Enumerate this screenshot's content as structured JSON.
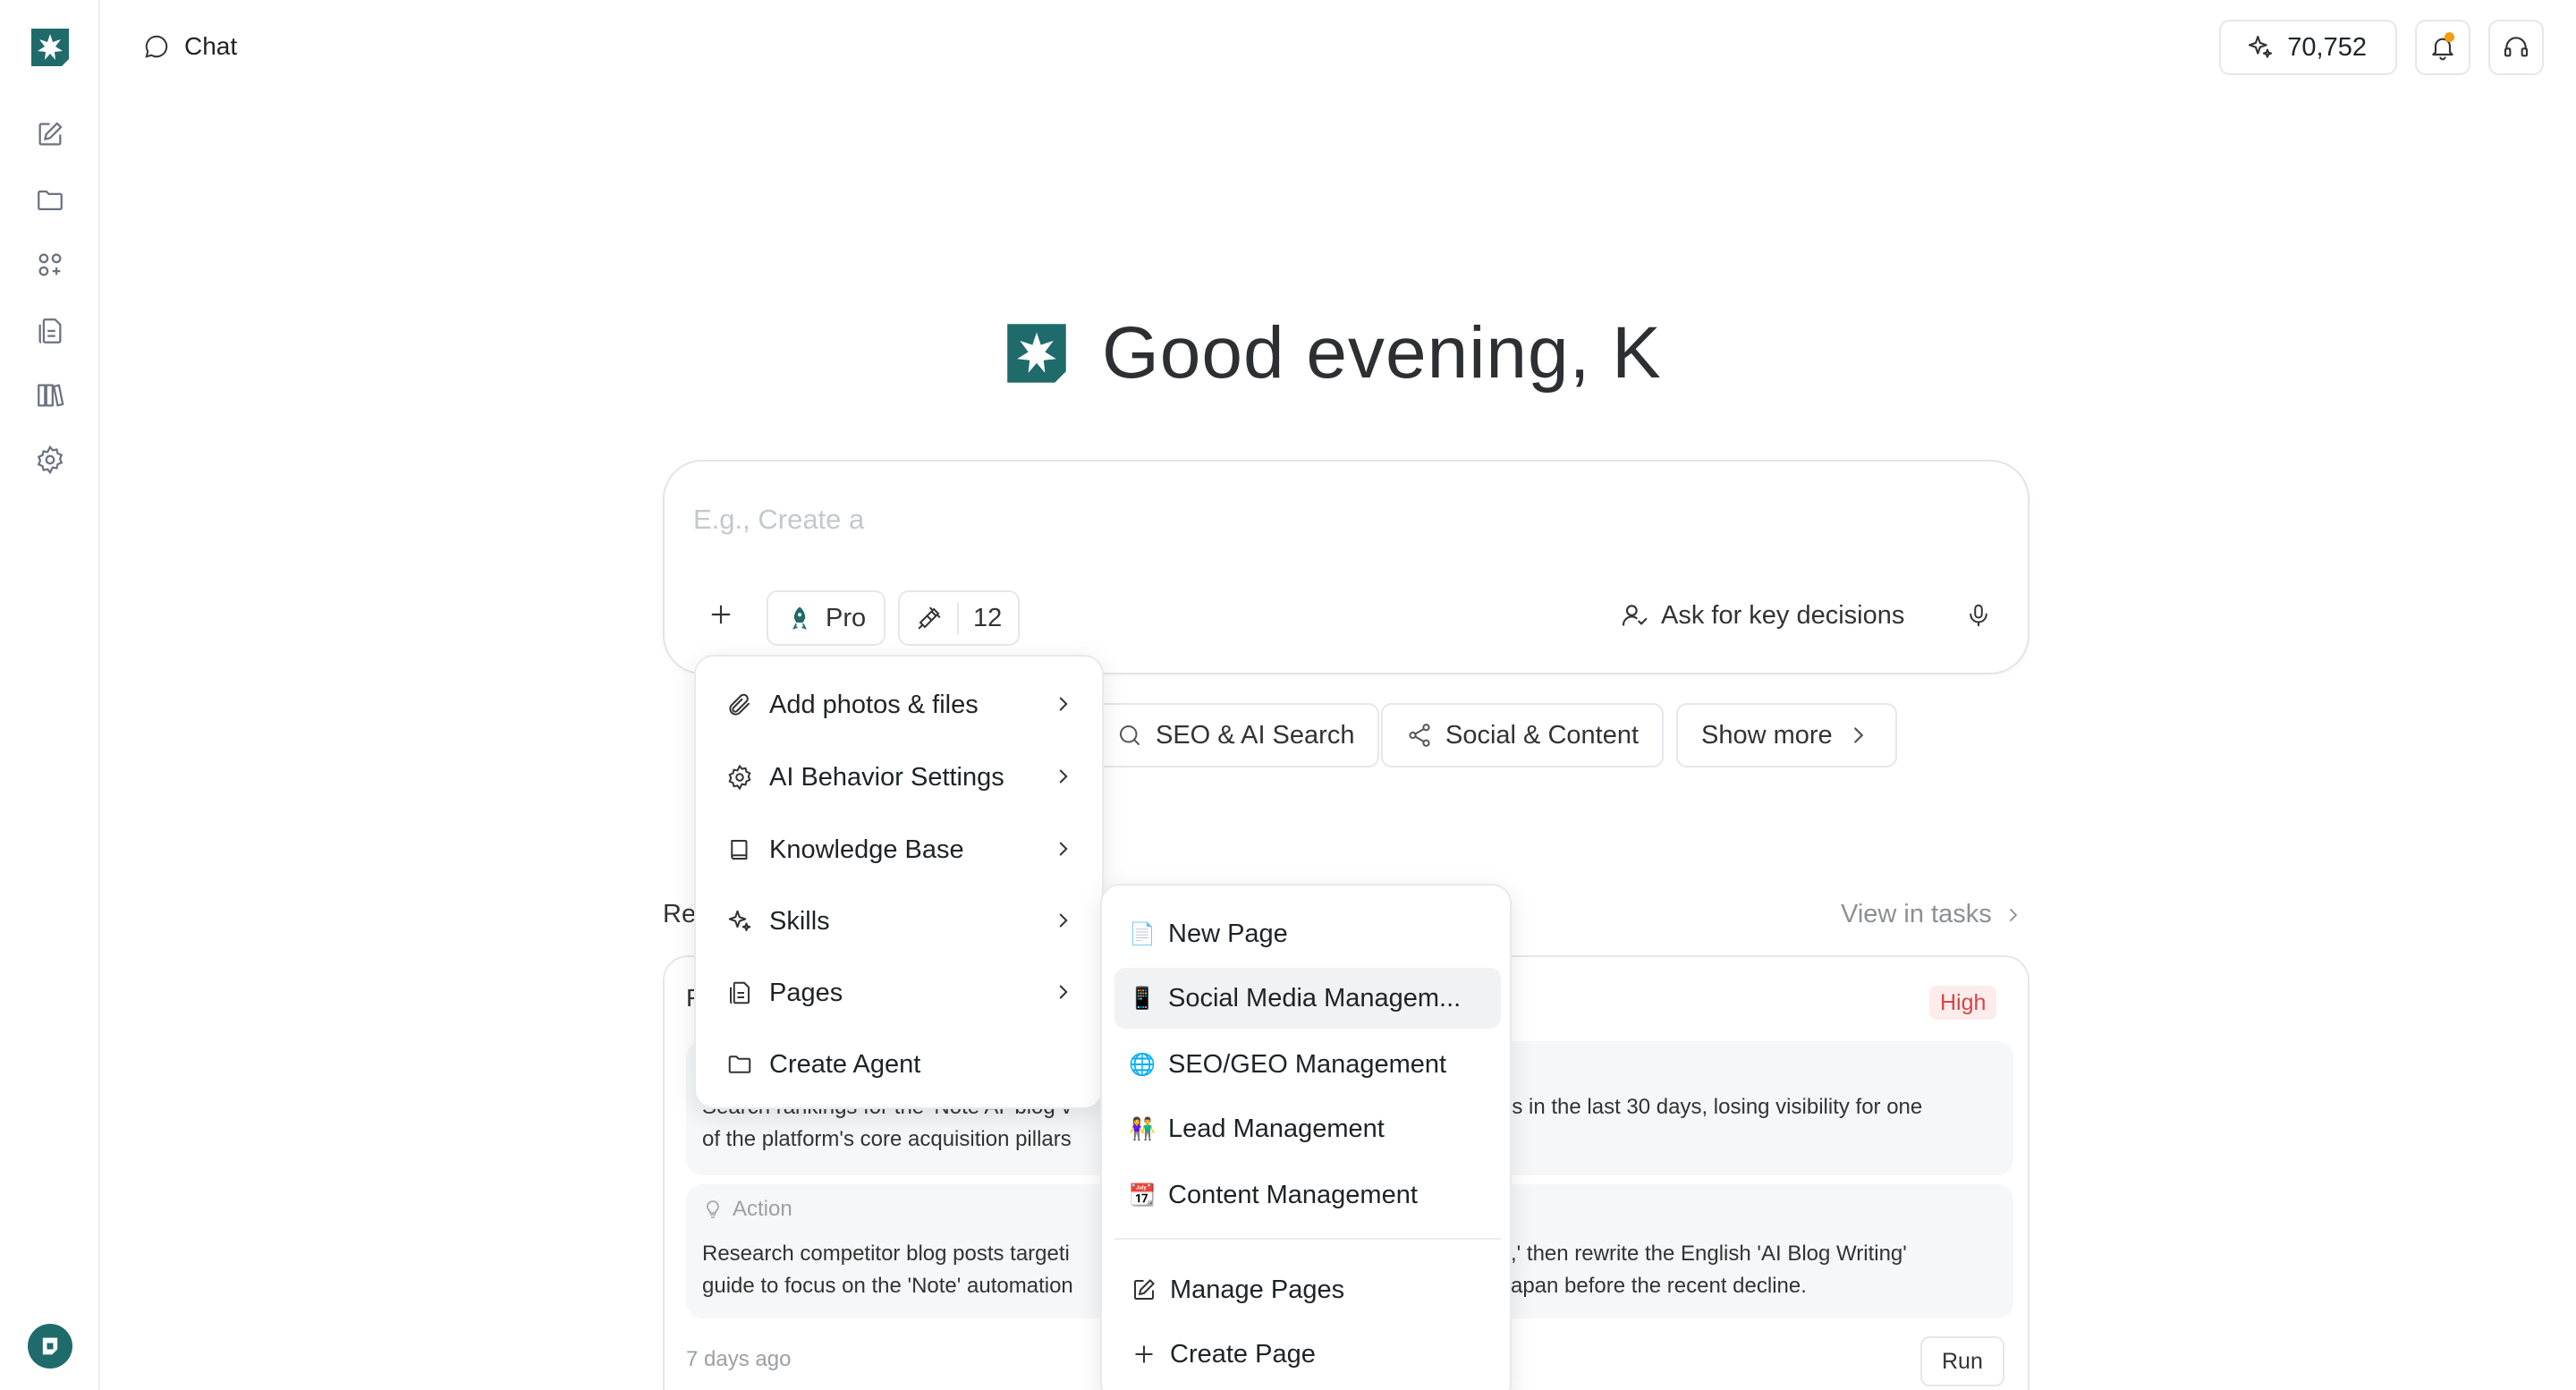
{
  "header": {
    "page_label": "Chat",
    "credits": "70,752"
  },
  "greeting": "Good evening, K",
  "composer": {
    "placeholder": "E.g., Create a",
    "mode_label": "Pro",
    "tools_count": "12",
    "ask_label": "Ask for key decisions"
  },
  "suggestions": [
    {
      "label": "SEO & AI Search",
      "icon": "search-icon"
    },
    {
      "label": "Social & Content",
      "icon": "share-icon"
    },
    {
      "label": "Show more",
      "icon": "chevron-right-icon"
    }
  ],
  "recommendations": {
    "title_visible": "Re",
    "view_tasks": "View in tasks",
    "card": {
      "lead_visible": "F",
      "priority": "High",
      "insight_left": "Search rankings for the 'Note AI' blog v\nof the platform's core acquisition pillars",
      "insight_right": "ns in the last 30 days, losing visibility for one",
      "action_label": "Action",
      "action_left": "Research competitor blog posts targeti\nguide to focus on the 'Note' automation",
      "action_right": "s,' then rewrite the English 'AI Blog Writing'\nJapan before the recent decline.",
      "time_ago": "7 days ago",
      "run_label": "Run"
    }
  },
  "menu": {
    "items": [
      {
        "label": "Add photos & files",
        "icon": "paperclip-icon",
        "has_submenu": true
      },
      {
        "label": "AI Behavior Settings",
        "icon": "gear-icon",
        "has_submenu": true
      },
      {
        "label": "Knowledge Base",
        "icon": "book-icon",
        "has_submenu": true
      },
      {
        "label": "Skills",
        "icon": "sparkle-icon",
        "has_submenu": true
      },
      {
        "label": "Pages",
        "icon": "pages-icon",
        "has_submenu": true
      },
      {
        "label": "Create Agent",
        "icon": "folder-icon",
        "has_submenu": false
      }
    ]
  },
  "submenu": {
    "items": [
      {
        "label": "New Page",
        "emoji": "📄"
      },
      {
        "label": "Social Media Managem...",
        "emoji": "📱",
        "active": true
      },
      {
        "label": "SEO/GEO Management",
        "emoji": "🌐"
      },
      {
        "label": "Lead Management",
        "emoji": "👫"
      },
      {
        "label": "Content Management",
        "emoji": "📆"
      }
    ],
    "actions": [
      {
        "label": "Manage Pages",
        "icon": "edit-icon"
      },
      {
        "label": "Create Page",
        "icon": "plus-icon"
      }
    ]
  },
  "colors": {
    "brand": "#1f6b6b",
    "high_badge_text": "#d64545",
    "high_badge_bg": "#fdecec",
    "notification_dot": "#f59e0b"
  }
}
